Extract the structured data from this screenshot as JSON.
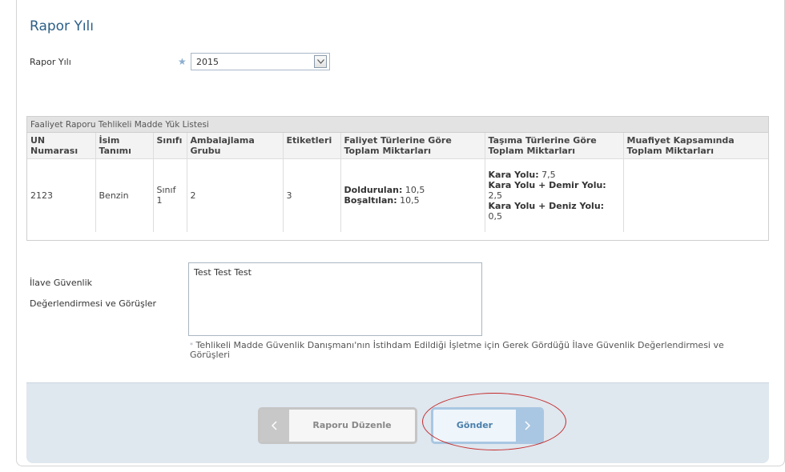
{
  "section": {
    "title": "Rapor Yılı"
  },
  "report_year": {
    "label": "Rapor Yılı",
    "required_mark": "★",
    "selected": "2015"
  },
  "grid": {
    "caption": "Faaliyet Raporu Tehlikeli Madde Yük Listesi",
    "headers": {
      "un": "UN Numarası",
      "name": "İsim Tanımı",
      "class": "Sınıfı",
      "packing": "Ambalajlama Grubu",
      "labels": "Etiketleri",
      "activity": "Faliyet Türlerine Göre Toplam Miktarları",
      "transport": "Taşıma Türlerine Göre Toplam Miktarları",
      "exempt": "Muafiyet Kapsamında Toplam Miktarları"
    },
    "row": {
      "un": "2123",
      "name": "Benzin",
      "class": "Sınıf 1",
      "packing": "2",
      "labels": "3",
      "activity_1_label": "Doldurulan:",
      "activity_1_value": " 10,5",
      "activity_2_label": "Boşaltılan:",
      "activity_2_value": " 10,5",
      "transport_1_label": "Kara Yolu:",
      "transport_1_value": " 7,5",
      "transport_2_label": "Kara Yolu + Demir Yolu:",
      "transport_2_value": " 2,5",
      "transport_3_label": "Kara Yolu + Deniz Yolu:",
      "transport_3_value": " 0,5",
      "exempt": ""
    }
  },
  "security": {
    "label_line1": "İlave Güvenlik",
    "label_line2": "Değerlendirmesi ve Görüşler",
    "value": "Test Test Test",
    "note_mark": "*",
    "note": "Tehlikeli Madde Güvenlik Danışmanı'nın İstihdam Edildiği İşletme için Gerek Gördüğü İlave Güvenlik Değerlendirmesi ve Görüşleri"
  },
  "buttons": {
    "edit": "Raporu Düzenle",
    "send": "Gönder"
  },
  "colors": {
    "title": "#2c5f86",
    "highlight_circle": "#c42a2a",
    "footer_bg": "#dfe7ef",
    "send_accent": "#a9c7e2"
  },
  "icons": {
    "dropdown": "chevron-down-icon",
    "edit_side": "chevron-left-icon",
    "send_side": "chevron-right-icon"
  }
}
